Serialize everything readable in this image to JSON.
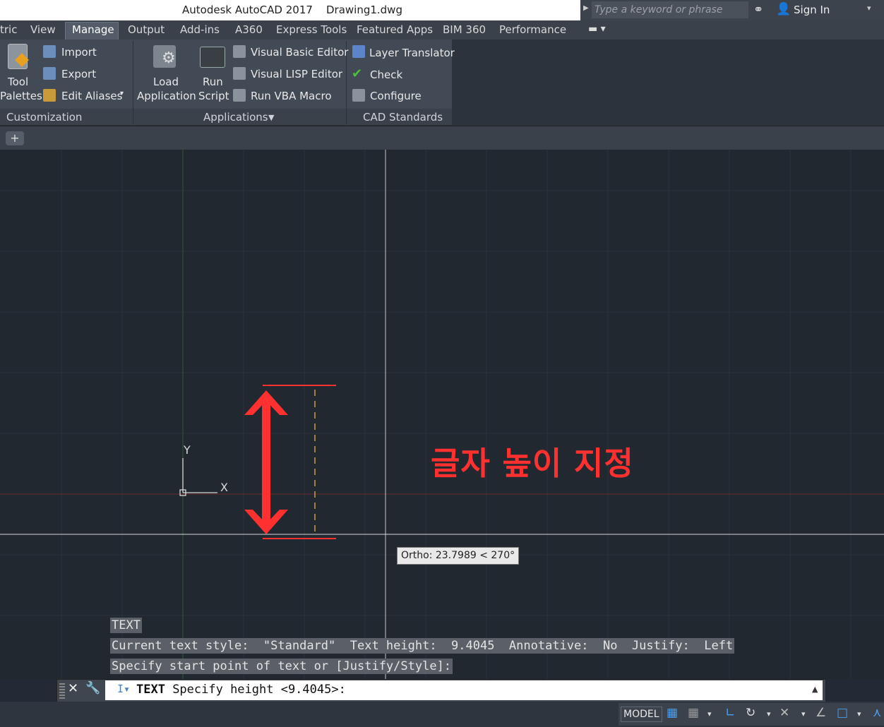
{
  "window": {
    "title": "Autodesk AutoCAD 2017    Drawing1.dwg",
    "search_placeholder": "Type a keyword or phrase",
    "sign_in": "Sign In"
  },
  "ribbon_tabs": [
    "tric",
    "View",
    "Manage",
    "Output",
    "Add-ins",
    "A360",
    "Express Tools",
    "Featured Apps",
    "BIM 360",
    "Performance"
  ],
  "active_tab": "Manage",
  "panels": {
    "customization": {
      "title": "Customization",
      "tool_palettes_1": "Tool",
      "tool_palettes_2": "Palettes",
      "import": "Import",
      "export": "Export",
      "edit_aliases": "Edit Aliases"
    },
    "applications": {
      "title": "Applications",
      "load_app_1": "Load",
      "load_app_2": "Application",
      "run_script_1": "Run",
      "run_script_2": "Script",
      "vba_editor": "Visual Basic Editor",
      "lisp_editor": "Visual LISP Editor",
      "run_vba": "Run VBA Macro"
    },
    "cad_standards": {
      "title": "CAD Standards",
      "layer_translator": "Layer Translator",
      "check": "Check",
      "configure": "Configure"
    }
  },
  "file_tabs": {
    "new_tab": "+"
  },
  "canvas": {
    "ucs_y": "Y",
    "ucs_x": "X",
    "annotation": "글자 높이 지정",
    "ortho_tooltip": "Ortho: 23.7989 < 270°"
  },
  "command_history": [
    "TEXT",
    "Current text style:  \"Standard\"  Text height:  9.4045  Annotative:  No  Justify:  Left",
    "Specify start point of text or [Justify/Style]:"
  ],
  "command_line": {
    "command": "TEXT",
    "prompt": " Specify height <9.4045>:"
  },
  "status_bar": {
    "model": "MODEL"
  },
  "colors": {
    "annotation_red": "#ff3030",
    "canvas_bg": "#212830",
    "ribbon_bg": "#424a55"
  }
}
